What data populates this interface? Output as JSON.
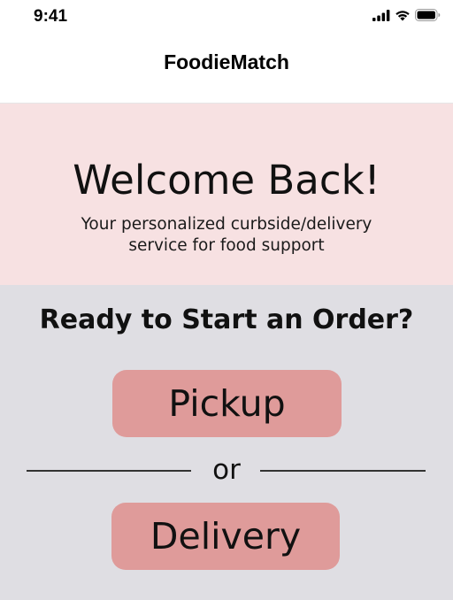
{
  "status_bar": {
    "time": "9:41",
    "icons": [
      "cellular-signal-icon",
      "wifi-icon",
      "battery-icon"
    ]
  },
  "nav": {
    "title": "FoodieMatch"
  },
  "hero": {
    "title": "Welcome Back!",
    "subtitle": "Your personalized curbside/delivery service for food support",
    "background": "#f7e1e2"
  },
  "order": {
    "heading": "Ready to Start an Order?",
    "pickup_label": "Pickup",
    "divider_text": "or",
    "delivery_label": "Delivery",
    "background": "#dfdee3",
    "button_color": "#df9b9a"
  }
}
